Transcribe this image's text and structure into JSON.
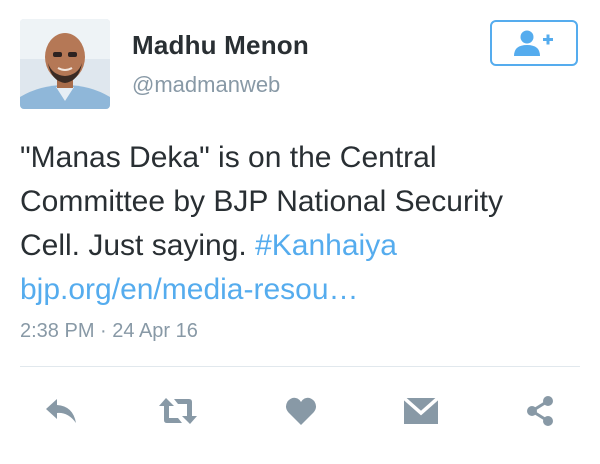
{
  "user": {
    "name": "Madhu Menon",
    "handle": "@madmanweb"
  },
  "tweet": {
    "text_line1": "\"Manas Deka\" is on the Central",
    "text_line2": "Committee by BJP National Security",
    "text_line3_prefix": "Cell. Just saying. ",
    "hashtag": "#Kanhaiya",
    "link": "bjp.org/en/media-resou…",
    "time": "2:38 PM",
    "separator": " · ",
    "date": "24 Apr 16"
  },
  "follow_button": {
    "icon": "add-user-icon"
  },
  "actions": [
    {
      "icon": "reply-icon"
    },
    {
      "icon": "retweet-icon"
    },
    {
      "icon": "like-heart-icon"
    },
    {
      "icon": "direct-message-icon"
    },
    {
      "icon": "share-icon"
    }
  ],
  "colors": {
    "accent": "#55acee",
    "text": "#292f33",
    "muted": "#8899a6",
    "action_icon": "#8899a6",
    "divider": "#e1e8ed"
  }
}
